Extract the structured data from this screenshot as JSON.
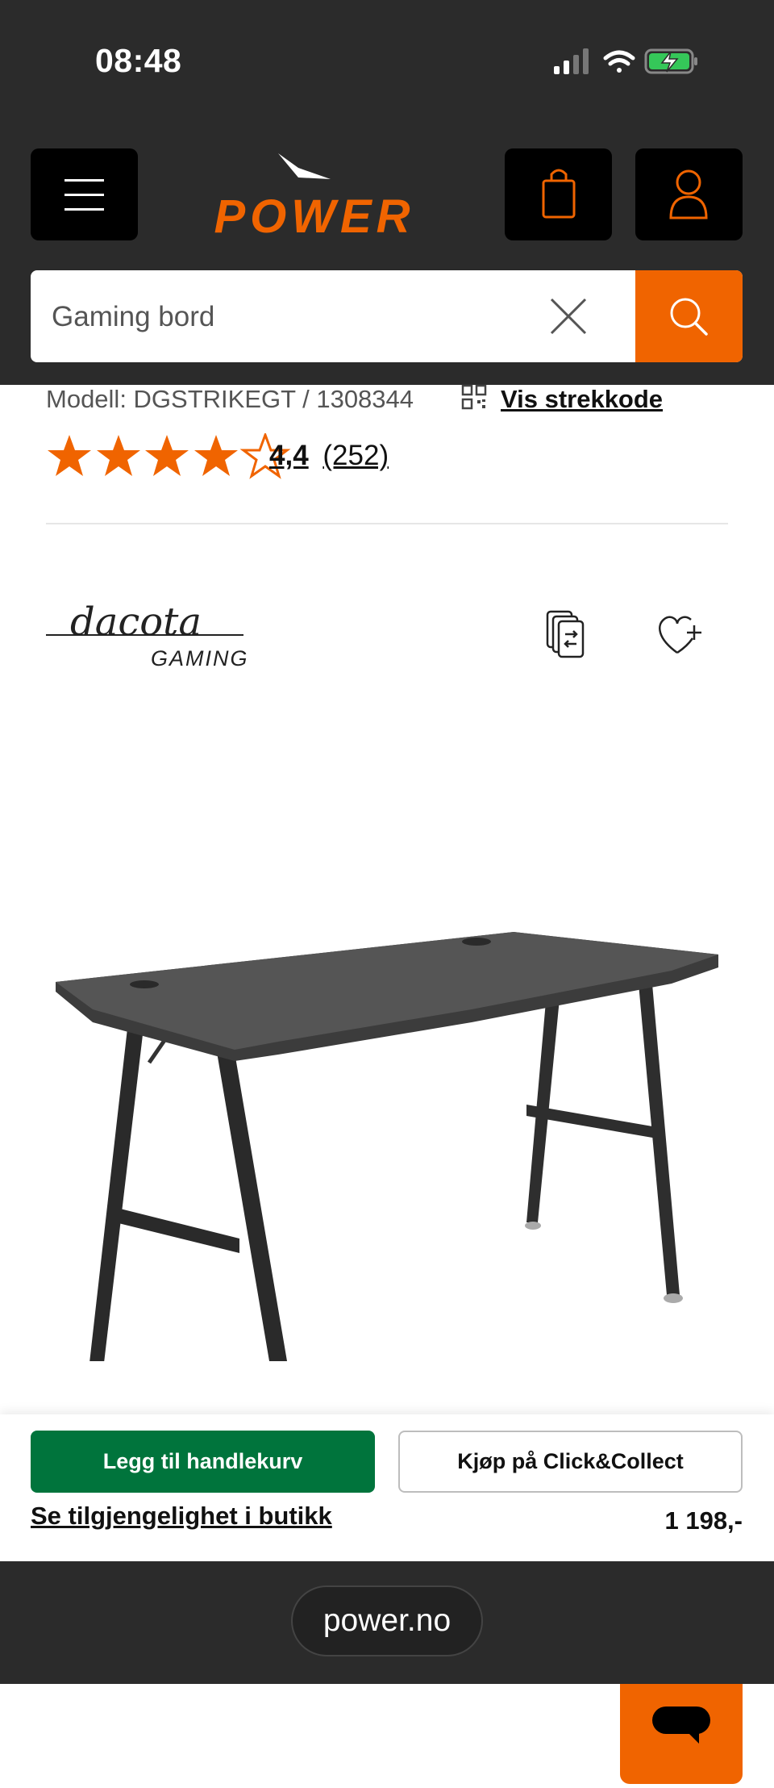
{
  "status_bar": {
    "time": "08:48"
  },
  "header": {
    "logo_text": "POWER",
    "brand_color": "#f06400",
    "menu_icon": "hamburger-icon",
    "cart_icon": "shopping-bag-icon",
    "account_icon": "user-icon"
  },
  "search": {
    "value": "Gaming bord",
    "clear_icon": "close-icon",
    "submit_icon": "search-icon"
  },
  "product": {
    "model_text": "Modell: DGSTRIKEGT / 1308344",
    "barcode_link": "Vis strekkode",
    "rating_value": 4.4,
    "rating_score": "4,4",
    "rating_count": "(252)",
    "stars_filled": 4,
    "stars_total": 5,
    "brand_name": "dacota",
    "brand_sub": "GAMING"
  },
  "actions": {
    "add_to_cart": "Legg til handlekurv",
    "click_collect": "Kjøp på Click&Collect",
    "store_availability": "Se tilgjengelighet i butikk",
    "price": "1 198,-",
    "add_to_cart_color": "#00743c"
  },
  "browser": {
    "url": "power.no"
  }
}
